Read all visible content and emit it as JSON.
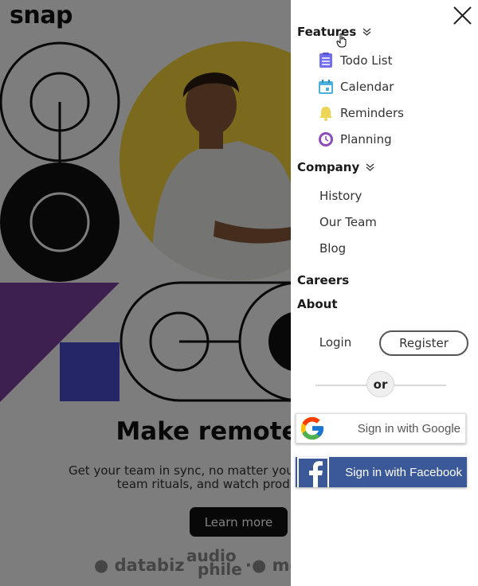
{
  "background_page": {
    "logo": "snap",
    "hero_title": "Make remote",
    "hero_text_line1": "Get your team in sync, no matter your location.",
    "hero_text_line2": "team rituals, and watch produ",
    "learn_more_label": "Learn more",
    "brands": [
      "databiz",
      "audio",
      "phile",
      "me"
    ]
  },
  "menu": {
    "features": {
      "label": "Features",
      "items": [
        {
          "label": "Todo List",
          "icon": "todo-list-icon",
          "color": "#726CEE"
        },
        {
          "label": "Calendar",
          "icon": "calendar-icon",
          "color": "#4BB1DA"
        },
        {
          "label": "Reminders",
          "icon": "bell-icon",
          "color": "#EDD556"
        },
        {
          "label": "Planning",
          "icon": "planning-clock-icon",
          "color": "#8E4CB6"
        }
      ]
    },
    "company": {
      "label": "Company",
      "items": [
        "History",
        "Our Team",
        "Blog"
      ]
    },
    "careers_label": "Careers",
    "about_label": "About",
    "login_label": "Login",
    "register_label": "Register",
    "or_label": "or",
    "google_label": "Sign in with Google",
    "facebook_label": "Sign in with Facebook"
  },
  "colors": {
    "facebook_blue": "#3B5998",
    "hero_circle": "#F6D33A",
    "shape_purple": "#7B3FA0",
    "shape_blue": "#4A4CD0"
  }
}
